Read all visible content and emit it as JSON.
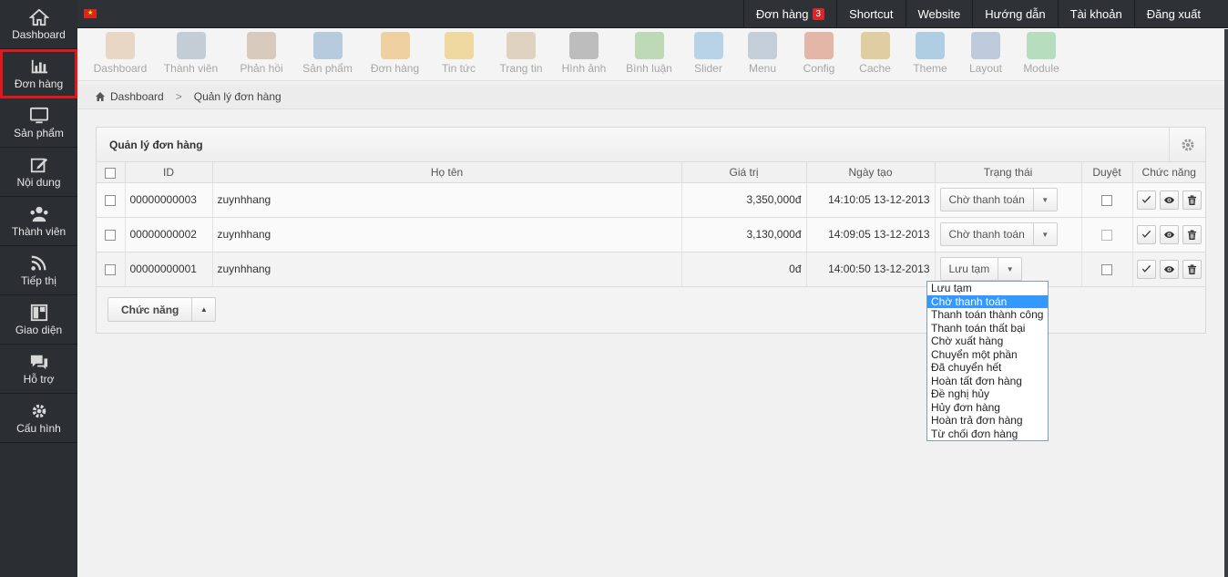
{
  "sidebar": {
    "items": [
      {
        "label": "Dashboard",
        "icon": "home-icon"
      },
      {
        "label": "Đơn hàng",
        "icon": "bar-chart-icon",
        "active": true
      },
      {
        "label": "Sản phẩm",
        "icon": "monitor-icon"
      },
      {
        "label": "Nội dung",
        "icon": "edit-icon"
      },
      {
        "label": "Thành viên",
        "icon": "users-icon"
      },
      {
        "label": "Tiếp thị",
        "icon": "rss-icon"
      },
      {
        "label": "Giao diện",
        "icon": "layout-icon"
      },
      {
        "label": "Hỗ trợ",
        "icon": "chat-icon"
      },
      {
        "label": "Cấu hình",
        "icon": "gear-icon"
      }
    ]
  },
  "topnav": {
    "orders_label": "Đơn hàng",
    "orders_badge": "3",
    "shortcut": "Shortcut",
    "website": "Website",
    "guide": "Hướng dẫn",
    "account": "Tài khoản",
    "logout": "Đăng xuất"
  },
  "toolbar": {
    "items": [
      {
        "label": "Dashboard",
        "icon": "home-icon",
        "color": "#d9b38c"
      },
      {
        "label": "Thành viên",
        "icon": "user-icon",
        "color": "#8a9bb0"
      },
      {
        "label": "Phản hồi",
        "icon": "feedback-icon",
        "color": "#b59a7a"
      },
      {
        "label": "Sản phẩm",
        "icon": "store-icon",
        "color": "#6b9ac4"
      },
      {
        "label": "Đơn hàng",
        "icon": "order-list-icon",
        "color": "#e8a33a"
      },
      {
        "label": "Tin tức",
        "icon": "news-icon",
        "color": "#e8b83a"
      },
      {
        "label": "Trang tin",
        "icon": "page-edit-icon",
        "color": "#c8a880"
      },
      {
        "label": "Hình ảnh",
        "icon": "camera-icon",
        "color": "#7a7a7a"
      },
      {
        "label": "Bình luận",
        "icon": "comment-icon",
        "color": "#7ab86a"
      },
      {
        "label": "Slider",
        "icon": "slider-icon",
        "color": "#6fa8d6"
      },
      {
        "label": "Menu",
        "icon": "menu-icon",
        "color": "#8aa0b5"
      },
      {
        "label": "Config",
        "icon": "tools-icon",
        "color": "#d06a4a"
      },
      {
        "label": "Cache",
        "icon": "broom-icon",
        "color": "#c8a040"
      },
      {
        "label": "Theme",
        "icon": "theme-icon",
        "color": "#5aa0d0"
      },
      {
        "label": "Layout",
        "icon": "layout-edit-icon",
        "color": "#7a9ac0"
      },
      {
        "label": "Module",
        "icon": "cubes-icon",
        "color": "#6ac07a"
      }
    ]
  },
  "breadcrumb": {
    "home": "Dashboard",
    "current": "Quản lý đơn hàng"
  },
  "panel": {
    "title": "Quản lý đơn hàng",
    "columns": {
      "id": "ID",
      "name": "Họ tên",
      "value": "Giá trị",
      "created": "Ngày tạo",
      "status": "Trạng thái",
      "approve": "Duyệt",
      "actions": "Chức năng"
    },
    "rows": [
      {
        "id": "00000000003",
        "name": "zuynhhang",
        "value": "3,350,000đ",
        "created": "14:10:05 13-12-2013",
        "status": "Chờ thanh toán"
      },
      {
        "id": "00000000002",
        "name": "zuynhhang",
        "value": "3,130,000đ",
        "created": "14:09:05 13-12-2013",
        "status": "Chờ thanh toán"
      },
      {
        "id": "00000000001",
        "name": "zuynhhang",
        "value": "0đ",
        "created": "14:00:50 13-12-2013",
        "status": "Lưu tạm"
      }
    ],
    "bulk_label": "Chức năng"
  },
  "dropdown": {
    "options": [
      "Lưu tạm",
      "Chờ thanh toán",
      "Thanh toán thành công",
      "Thanh toán thất bại",
      "Chờ xuất hàng",
      "Chuyển một phần",
      "Đã chuyển hết",
      "Hoàn tất đơn hàng",
      "Đề nghị hủy",
      "Hủy đơn hàng",
      "Hoàn trả đơn hàng",
      "Từ chối đơn hàng"
    ],
    "highlighted": "Chờ thanh toán"
  }
}
